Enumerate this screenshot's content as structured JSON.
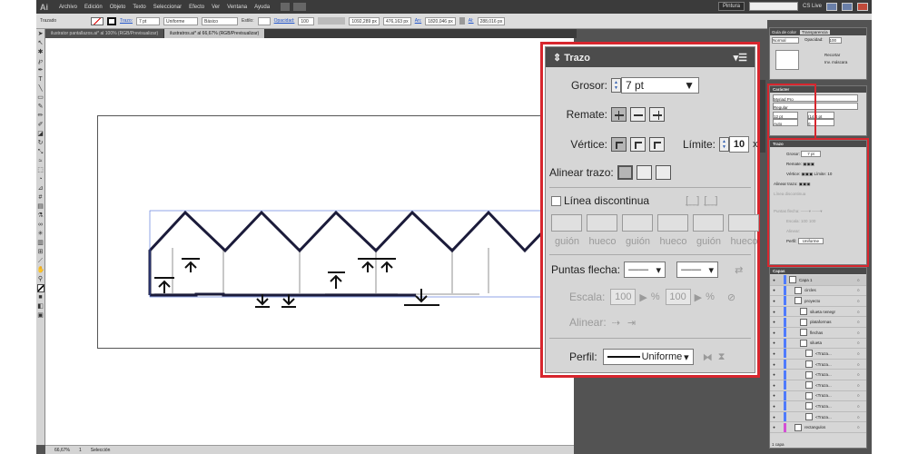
{
  "menubar": {
    "logo": "Ai",
    "items": [
      "Archivo",
      "Edición",
      "Objeto",
      "Texto",
      "Seleccionar",
      "Efecto",
      "Ver",
      "Ventana",
      "Ayuda"
    ],
    "workspace": "Pintura",
    "cslive": "CS Live"
  },
  "control_bar": {
    "mode_label": "Trazado",
    "stroke_label": "Trazo:",
    "stroke_weight": "7 pt",
    "profile": "Uniforme",
    "brush": "Básico",
    "style_label": "Estilo:",
    "opacity_label": "Opacidad:",
    "opacity_value": "100",
    "x_value": "1092,289 px",
    "y_value": "476,163 px",
    "w_label": "An:",
    "w_value": "1820,046 px",
    "h_label": "Al:",
    "h_value": "288,016 px"
  },
  "doc_tabs": [
    "ilustrator pantallazos.ai* al 100% (RGB/Previsualizar)",
    "ilustratros.ai* al 66,67% (RGB/Previsualizar)"
  ],
  "status": {
    "zoom": "66,67%",
    "page": "1",
    "tool": "Selección"
  },
  "stroke_panel": {
    "title": "Trazo",
    "weight_label": "Grosor:",
    "weight_value": "7 pt",
    "cap_label": "Remate:",
    "corner_label": "Vértice:",
    "limit_label": "Límite:",
    "limit_value": "10",
    "limit_unit": "x",
    "align_label": "Alinear trazo:",
    "dashed_label": "Línea discontinua",
    "dash_labels": [
      "guión",
      "hueco",
      "guión",
      "hueco",
      "guión",
      "hueco"
    ],
    "arrowheads_label": "Puntas flecha:",
    "scale_label": "Escala:",
    "scale_1": "100",
    "scale_2": "100",
    "percent": "%",
    "align_arrows_label": "Alinear:",
    "profile_label": "Perfil:",
    "profile_value": "Uniforme"
  },
  "transparency_panel": {
    "tabs": [
      "Guía de color",
      "Transparencia"
    ],
    "mode": "Normal",
    "opacity_label": "Opacidad:",
    "opacity_value": "100",
    "clip_label": "Recortar",
    "invert_label": "Inv. máscara"
  },
  "character_panel": {
    "title": "Carácter",
    "font": "Myriad Pro",
    "style": "Regular",
    "size": "12 pt",
    "leading": "(14,4 pt",
    "kerning": "Auto",
    "tracking": "0"
  },
  "mini_stroke_panel": {
    "title": "Trazo",
    "weight_label": "Grosor:",
    "weight_value": "7 pt",
    "cap_label": "Remate:",
    "corner_label": "Vértice:",
    "limit_label": "Límite:",
    "limit_value": "10",
    "align_label": "Alinear trazo:",
    "dashed_label": "Línea discontinua",
    "arrow_label": "Puntas flecha:",
    "scale_label": "Escala:",
    "scale_1": "100",
    "scale_2": "100",
    "align_label2": "Alinear:",
    "profile_label": "Perfil:",
    "profile_value": "Uniforme"
  },
  "layers_panel": {
    "title": "Capas",
    "footer": "1 capa",
    "rows": [
      {
        "name": "Capa 1",
        "indent": 0,
        "color": "#4f7bff"
      },
      {
        "name": "circles",
        "indent": 1,
        "color": "#4f7bff"
      },
      {
        "name": "proyecto",
        "indent": 1,
        "color": "#4f7bff"
      },
      {
        "name": "silueta rwnegr",
        "indent": 2,
        "color": "#4f7bff"
      },
      {
        "name": "plataformas",
        "indent": 2,
        "color": "#4f7bff"
      },
      {
        "name": "flechas",
        "indent": 2,
        "color": "#4f7bff"
      },
      {
        "name": "silueta",
        "indent": 2,
        "color": "#4f7bff"
      },
      {
        "name": "<Traza...",
        "indent": 3,
        "color": "#4f7bff"
      },
      {
        "name": "<Traza...",
        "indent": 3,
        "color": "#4f7bff"
      },
      {
        "name": "<Traza...",
        "indent": 3,
        "color": "#4f7bff"
      },
      {
        "name": "<Traza...",
        "indent": 3,
        "color": "#4f7bff"
      },
      {
        "name": "<Traza...",
        "indent": 3,
        "color": "#4f7bff"
      },
      {
        "name": "<Traza...",
        "indent": 3,
        "color": "#4f7bff"
      },
      {
        "name": "<Traza...",
        "indent": 3,
        "color": "#4f7bff"
      },
      {
        "name": "rectangulos",
        "indent": 1,
        "color": "#d44fd4"
      }
    ]
  },
  "colors": {
    "highlight": "#d7262e",
    "stroke_dark": "#1b1b3a",
    "selection": "#4a6ad8"
  }
}
